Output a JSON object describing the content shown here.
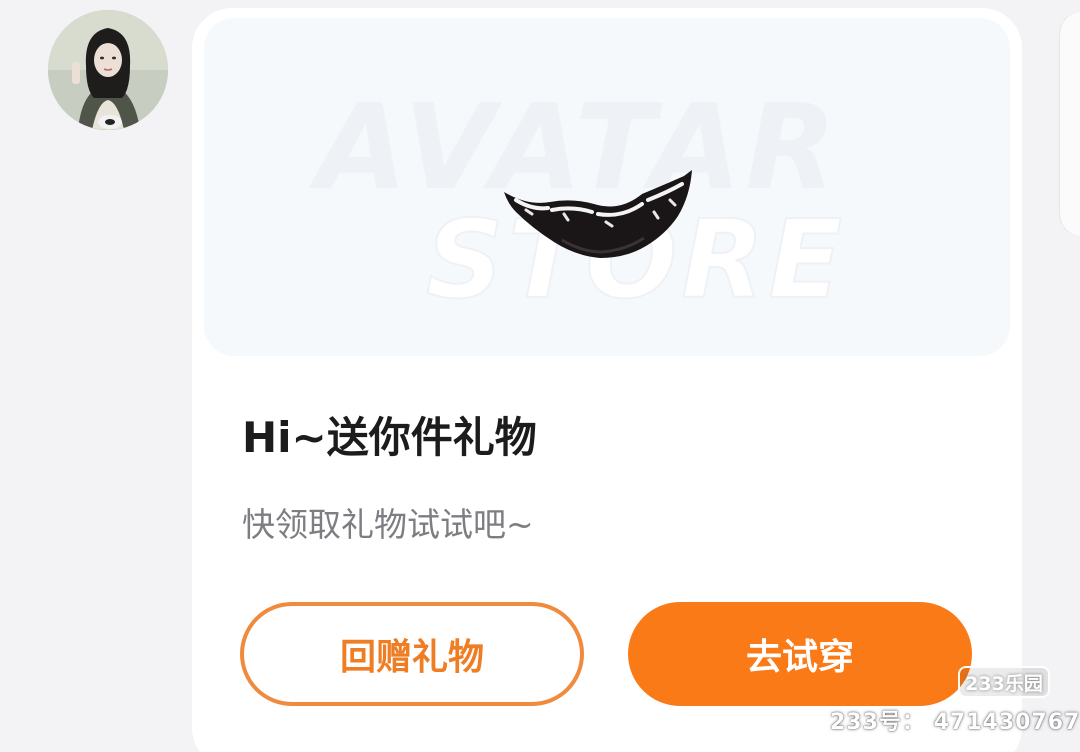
{
  "banner": {
    "watermark_line1": "AVATAR",
    "watermark_line2": "STORE",
    "item_image": "teeth-accessory"
  },
  "card": {
    "title": "Hi~送你件礼物",
    "subtitle": "快领取礼物试试吧~"
  },
  "actions": {
    "return_gift_label": "回赠礼物",
    "try_on_label": "去试穿"
  },
  "platform_watermark": {
    "badge": "233乐园",
    "id_text": "233号： 471430767"
  },
  "colors": {
    "accent": "#fb7a18",
    "accent_border": "#f08a3c",
    "title": "#1c1c1c",
    "subtitle": "#7d7d82",
    "page_bg": "#f3f3f5"
  }
}
